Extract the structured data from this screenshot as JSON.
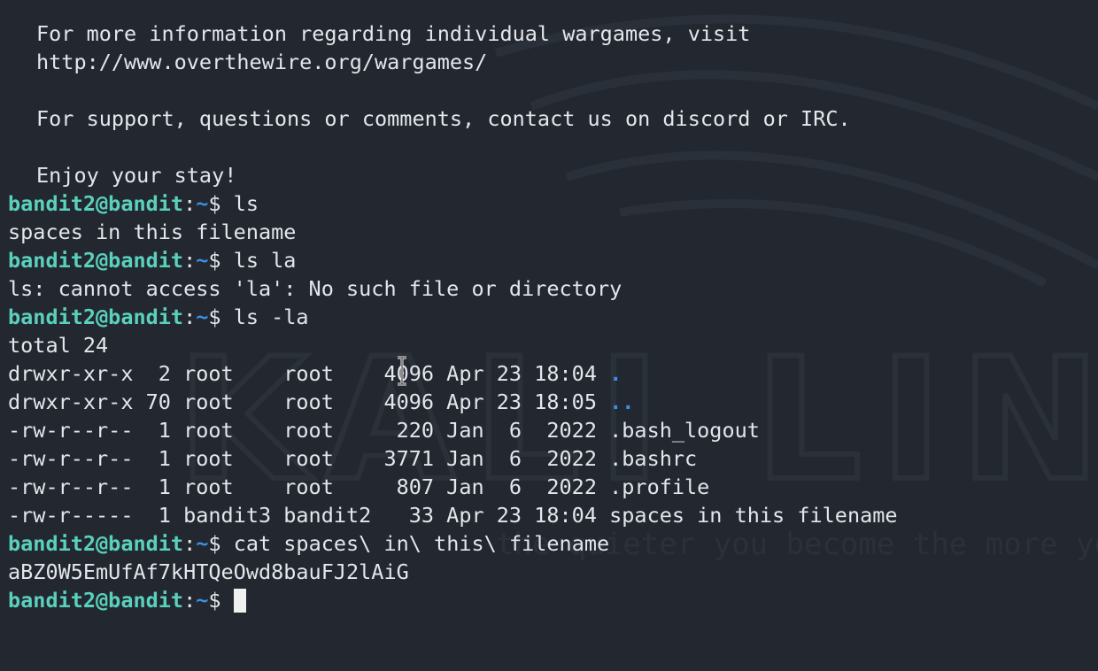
{
  "motd": [
    "For more information regarding individual wargames, visit",
    "http://www.overthewire.org/wargames/",
    "",
    "For support, questions or comments, contact us on discord or IRC.",
    "",
    "Enjoy your stay!"
  ],
  "prompt": {
    "user_host": "bandit2@bandit",
    "separator": ":",
    "path": "~",
    "dollar": "$ "
  },
  "session": [
    {
      "type": "prompt",
      "command": "ls"
    },
    {
      "type": "output",
      "text": "spaces in this filename"
    },
    {
      "type": "prompt",
      "command": "ls la"
    },
    {
      "type": "output",
      "text": "ls: cannot access 'la': No such file or directory"
    },
    {
      "type": "prompt",
      "command": "ls -la"
    },
    {
      "type": "output",
      "text": "total 24"
    },
    {
      "type": "listing",
      "text": "drwxr-xr-x  2 root    root    4096 Apr 23 18:04 ",
      "name": ".",
      "is_dir": true
    },
    {
      "type": "listing",
      "text": "drwxr-xr-x 70 root    root    4096 Apr 23 18:05 ",
      "name": "..",
      "is_dir": true
    },
    {
      "type": "listing",
      "text": "-rw-r--r--  1 root    root     220 Jan  6  2022 ",
      "name": ".bash_logout",
      "is_dir": false
    },
    {
      "type": "listing",
      "text": "-rw-r--r--  1 root    root    3771 Jan  6  2022 ",
      "name": ".bashrc",
      "is_dir": false
    },
    {
      "type": "listing",
      "text": "-rw-r--r--  1 root    root     807 Jan  6  2022 ",
      "name": ".profile",
      "is_dir": false
    },
    {
      "type": "listing",
      "text": "-rw-r-----  1 bandit3 bandit2   33 Apr 23 18:04 ",
      "name": "spaces in this filename",
      "is_dir": false
    },
    {
      "type": "prompt",
      "command": "cat spaces\\ in\\ this\\ filename"
    },
    {
      "type": "output",
      "text": "aBZ0W5EmUfAf7kHTQeOwd8bauFJ2lAiG"
    },
    {
      "type": "prompt",
      "command": "",
      "cursor": true
    }
  ],
  "watermark": {
    "logo_text": "KALI LINUX",
    "tagline": "the quieter you become the more you are able to hear"
  },
  "colors": {
    "background": "#232830",
    "text": "#e3e6ea",
    "prompt_user": "#5ad1bd",
    "prompt_path": "#3b8eea",
    "directory": "#3b8eea"
  }
}
